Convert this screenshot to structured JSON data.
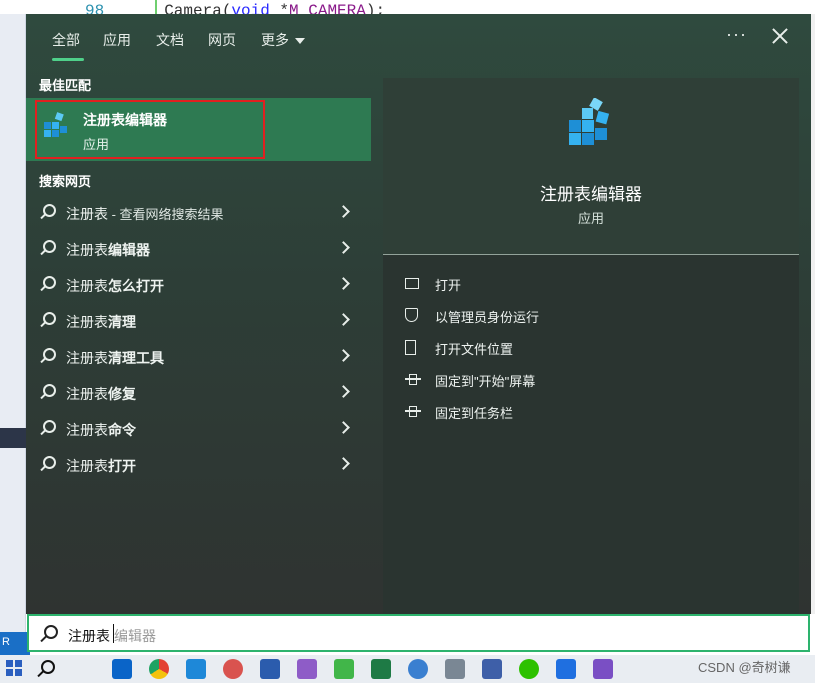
{
  "background": {
    "code_line_number": "98",
    "code_text_prefix": "Camera(",
    "code_keyword": "void",
    "code_text_middle": " *",
    "code_macro": "M_CAMERA",
    "code_text_suffix": ");",
    "status_bar_text": "R"
  },
  "tabs": [
    {
      "label": "全部",
      "active": true
    },
    {
      "label": "应用",
      "active": false
    },
    {
      "label": "文档",
      "active": false
    },
    {
      "label": "网页",
      "active": false
    },
    {
      "label": "更多",
      "active": false
    }
  ],
  "toolbar": {
    "more_options": "···"
  },
  "best_match": {
    "section_title": "最佳匹配",
    "name": "注册表编辑器",
    "type": "应用"
  },
  "web_search": {
    "section_title": "搜索网页",
    "items": [
      {
        "query": "注册表",
        "suffix": " - 查看网络搜索结果"
      },
      {
        "query": "注册表",
        "suffix": "编辑器"
      },
      {
        "query": "注册表",
        "suffix": "怎么打开"
      },
      {
        "query": "注册表",
        "suffix": "清理"
      },
      {
        "query": "注册表",
        "suffix": "清理工具"
      },
      {
        "query": "注册表",
        "suffix": "修复"
      },
      {
        "query": "注册表",
        "suffix": "命令"
      },
      {
        "query": "注册表",
        "suffix": "打开"
      }
    ]
  },
  "detail": {
    "title": "注册表编辑器",
    "subtitle": "应用",
    "actions": [
      {
        "label": "打开",
        "icon": "open-icon"
      },
      {
        "label": "以管理员身份运行",
        "icon": "admin-shield-icon"
      },
      {
        "label": "打开文件位置",
        "icon": "file-location-icon"
      },
      {
        "label": "固定到\"开始\"屏幕",
        "icon": "pin-icon"
      },
      {
        "label": "固定到任务栏",
        "icon": "pin-icon"
      }
    ]
  },
  "search_box": {
    "typed": "注册表",
    "autocomplete": "编辑器"
  },
  "taskbar": {
    "watermark": "CSDN @奇树谦",
    "apps": [
      "outlook-icon",
      "chrome-icon",
      "vscode-icon",
      "paint-icon",
      "word-icon",
      "visual-studio-icon",
      "qt-icon",
      "excel-icon",
      "network-icon",
      "calculator-icon",
      "remote-desktop-icon",
      "wechat-icon",
      "feishu-icon",
      "visual-studio-purple-icon"
    ]
  },
  "colors": {
    "accent_green": "#2db36d",
    "best_match_bg": "#2e7a52",
    "highlight_outline": "#e02020",
    "registry_icon_blue": "#2a9fe0"
  }
}
